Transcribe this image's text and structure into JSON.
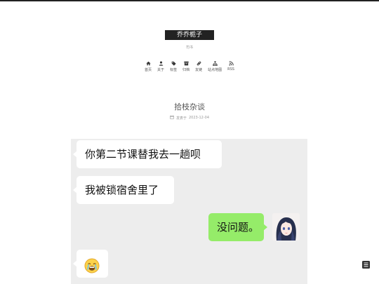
{
  "site": {
    "title": "乔乔栀子",
    "subtitle": "司书"
  },
  "nav": [
    {
      "label": "首页",
      "icon": "home-icon"
    },
    {
      "label": "关于",
      "icon": "user-icon"
    },
    {
      "label": "标签",
      "icon": "tag-icon"
    },
    {
      "label": "归档",
      "icon": "archive-icon"
    },
    {
      "label": "友链",
      "icon": "link-icon"
    },
    {
      "label": "站点地图",
      "icon": "sitemap-icon"
    },
    {
      "label": "RSS",
      "icon": "rss-icon"
    }
  ],
  "post": {
    "title": "拾枝杂谈",
    "meta_label": "发表于",
    "date": "2023-12-04",
    "meta_icon": "calendar-icon"
  },
  "chat": {
    "messages": [
      {
        "side": "left",
        "text": "你第二节课替我去一趟呗"
      },
      {
        "side": "left",
        "text": "我被锁宿舍里了"
      },
      {
        "side": "right",
        "text": "没问题。"
      },
      {
        "side": "left",
        "emoji": "crying-face"
      }
    ],
    "avatar": "anime-girl-avatar",
    "colors": {
      "background": "#ededed",
      "own_bubble": "#95ec69",
      "other_bubble": "#ffffff"
    }
  },
  "toc": {
    "icon": "list-icon"
  }
}
